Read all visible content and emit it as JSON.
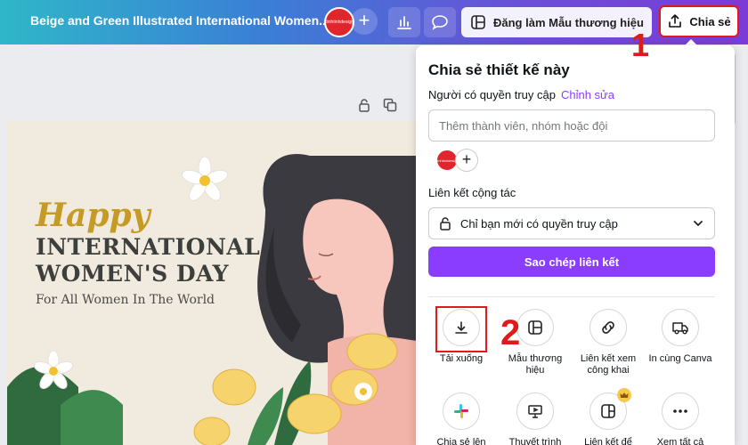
{
  "header": {
    "doc_title": "Beige and Green Illustrated International Women...",
    "brand_button": "Đăng làm Mẫu thương hiệu",
    "share_button": "Chia sẻ",
    "avatar_text": "dinhtinhdesign"
  },
  "design": {
    "happy": "Happy",
    "line1": "INTERNATIONAL",
    "line2": "WOMEN'S DAY",
    "subtitle": "For All Women In The World"
  },
  "share_panel": {
    "title": "Chia sẻ thiết kế này",
    "access_label": "Người có quyền truy cập",
    "edit_link": "Chỉnh sửa",
    "invite_placeholder": "Thêm thành viên, nhóm hoặc đội",
    "collab_label": "Liên kết cộng tác",
    "access_select": "Chỉ bạn mới có quyền truy cập",
    "copy_button": "Sao chép liên kết",
    "options_row1": [
      {
        "label": "Tải xuống",
        "icon": "download-icon"
      },
      {
        "label": "Mẫu thương hiệu",
        "icon": "template-icon"
      },
      {
        "label": "Liên kết xem công khai",
        "icon": "link-icon"
      },
      {
        "label": "In cùng Canva",
        "icon": "truck-icon"
      }
    ],
    "options_row2": [
      {
        "label": "Chia sẻ lên",
        "icon": "slack-icon"
      },
      {
        "label": "Thuyết trình",
        "icon": "present-icon"
      },
      {
        "label": "Liên kết để",
        "icon": "embed-icon"
      },
      {
        "label": "Xem tất cả",
        "icon": "more-icon"
      }
    ]
  },
  "annotations": {
    "step1": "1",
    "step2": "2"
  },
  "colors": {
    "accent": "#8b3dff",
    "highlight": "#e01a1a"
  }
}
